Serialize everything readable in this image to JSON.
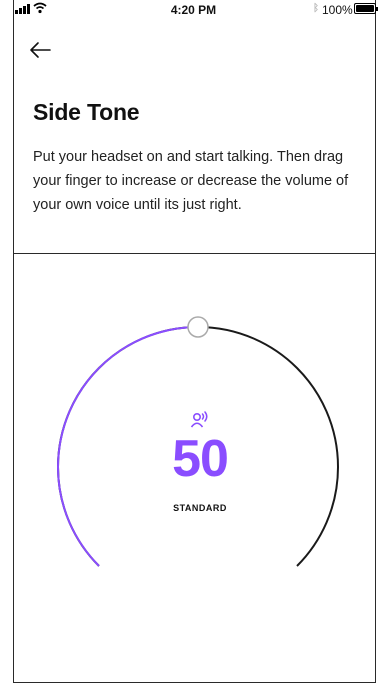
{
  "status_bar": {
    "time": "4:20 PM",
    "battery_percent": "100%",
    "icons": [
      "signal-icon",
      "wifi-icon",
      "bluetooth-icon",
      "battery-icon"
    ]
  },
  "header": {
    "back_icon": "back-arrow-icon",
    "title": "Side Tone",
    "description": "Put your headset on and start talking. Then drag your finger to increase or decrease the volume of your own voice until its just right."
  },
  "dial": {
    "value": "50",
    "level": 0.5,
    "level_label": "STANDARD",
    "icon": "voice-icon",
    "colors": {
      "accent": "#8a4dff",
      "track": "#1a1a1a",
      "handle_border": "#aaaaaa"
    }
  }
}
